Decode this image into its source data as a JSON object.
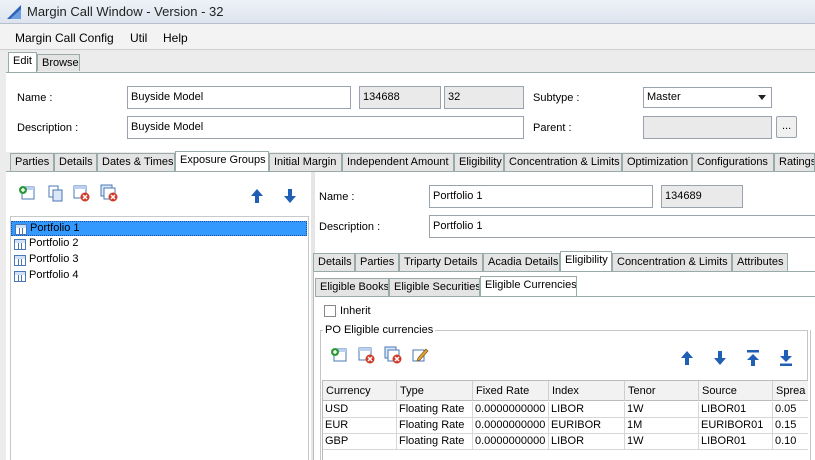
{
  "window": {
    "title": "Margin Call Window - Version - 32"
  },
  "menu": [
    "Margin Call Config",
    "Util",
    "Help"
  ],
  "mode_tabs": [
    "Edit",
    "Browse"
  ],
  "header": {
    "name_label": "Name :",
    "name_value": "Buyside Model",
    "id1": "134688",
    "version": "32",
    "subtype_label": "Subtype :",
    "subtype_value": "Master",
    "description_label": "Description :",
    "description_value": "Buyside  Model",
    "parent_label": "Parent :",
    "parent_value": "",
    "browse_label": "..."
  },
  "main_tabs": [
    "Parties",
    "Details",
    "Dates & Times",
    "Exposure Groups",
    "Initial Margin",
    "Independent Amount",
    "Eligibility",
    "Concentration & Limits",
    "Optimization",
    "Configurations",
    "Ratings"
  ],
  "tree": {
    "items": [
      "Portfolio 1",
      "Portfolio 2",
      "Portfolio 3",
      "Portfolio 4"
    ]
  },
  "portfolio": {
    "name_label": "Name :",
    "name_value": "Portfolio 1",
    "id": "134689",
    "description_label": "Description :",
    "description_value": "Portfolio 1"
  },
  "sub_tabs": [
    "Details",
    "Parties",
    "Triparty Details",
    "Acadia Details",
    "Eligibility",
    "Concentration & Limits",
    "Attributes"
  ],
  "elig_tabs": [
    "Eligible Books",
    "Eligible Securities",
    "Eligible Currencies"
  ],
  "inherit_label": "Inherit",
  "group_title": "PO Eligible currencies",
  "currency_table": {
    "headers": [
      "Currency",
      "Type",
      "Fixed Rate",
      "Index",
      "Tenor",
      "Source",
      "Sprea"
    ],
    "rows": [
      [
        "USD",
        "Floating Rate",
        "0.0000000000",
        "LIBOR",
        "1W",
        "LIBOR01",
        "0.05"
      ],
      [
        "EUR",
        "Floating Rate",
        "0.0000000000",
        "EURIBOR",
        "1M",
        "EURIBOR01",
        "0.15"
      ],
      [
        "GBP",
        "Floating Rate",
        "0.0000000000",
        "LIBOR",
        "1W",
        "LIBOR01",
        "0.10"
      ]
    ]
  },
  "colors": {
    "selection": "#3399ff",
    "tab_border": "#9aa",
    "accent_blue": "#1f5fb5"
  }
}
